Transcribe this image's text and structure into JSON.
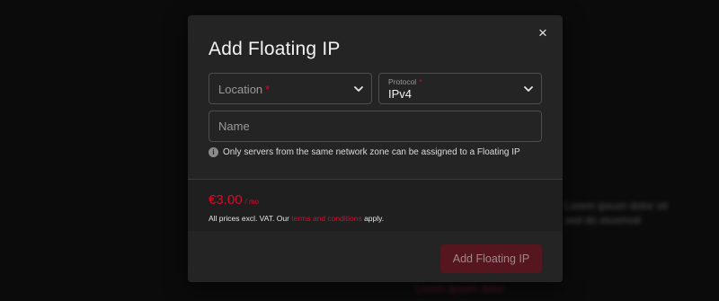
{
  "background": {
    "blur_text_1": "Lorem ipsum dolor sit",
    "blur_text_2": "sed do eiusmod",
    "blur_text_3": "Lorem ipsum dolor"
  },
  "modal": {
    "title": "Add Floating IP",
    "close_label": "×",
    "location": {
      "placeholder": "Location",
      "required_mark": "*"
    },
    "protocol": {
      "label": "Protocol",
      "required_mark": "*",
      "value": "IPv4"
    },
    "name_field": {
      "placeholder": "Name",
      "value": ""
    },
    "info": {
      "icon_glyph": "i",
      "text": "Only servers from the same network zone can be assigned to a Floating IP"
    },
    "pricing": {
      "price": "€3.00",
      "unit": "/ mo",
      "vat_prefix": "All prices excl. VAT. Our ",
      "terms_link": "terms and conditions",
      "vat_suffix": " apply."
    },
    "submit_label": "Add Floating IP"
  },
  "colors": {
    "accent": "#d50c2d",
    "modal_bg": "#242424",
    "page_bg": "#0b0b0c",
    "button_disabled": "#56161f"
  },
  "icons": {
    "close": "close-icon",
    "chevron": "chevron-down-icon",
    "info": "info-icon"
  }
}
